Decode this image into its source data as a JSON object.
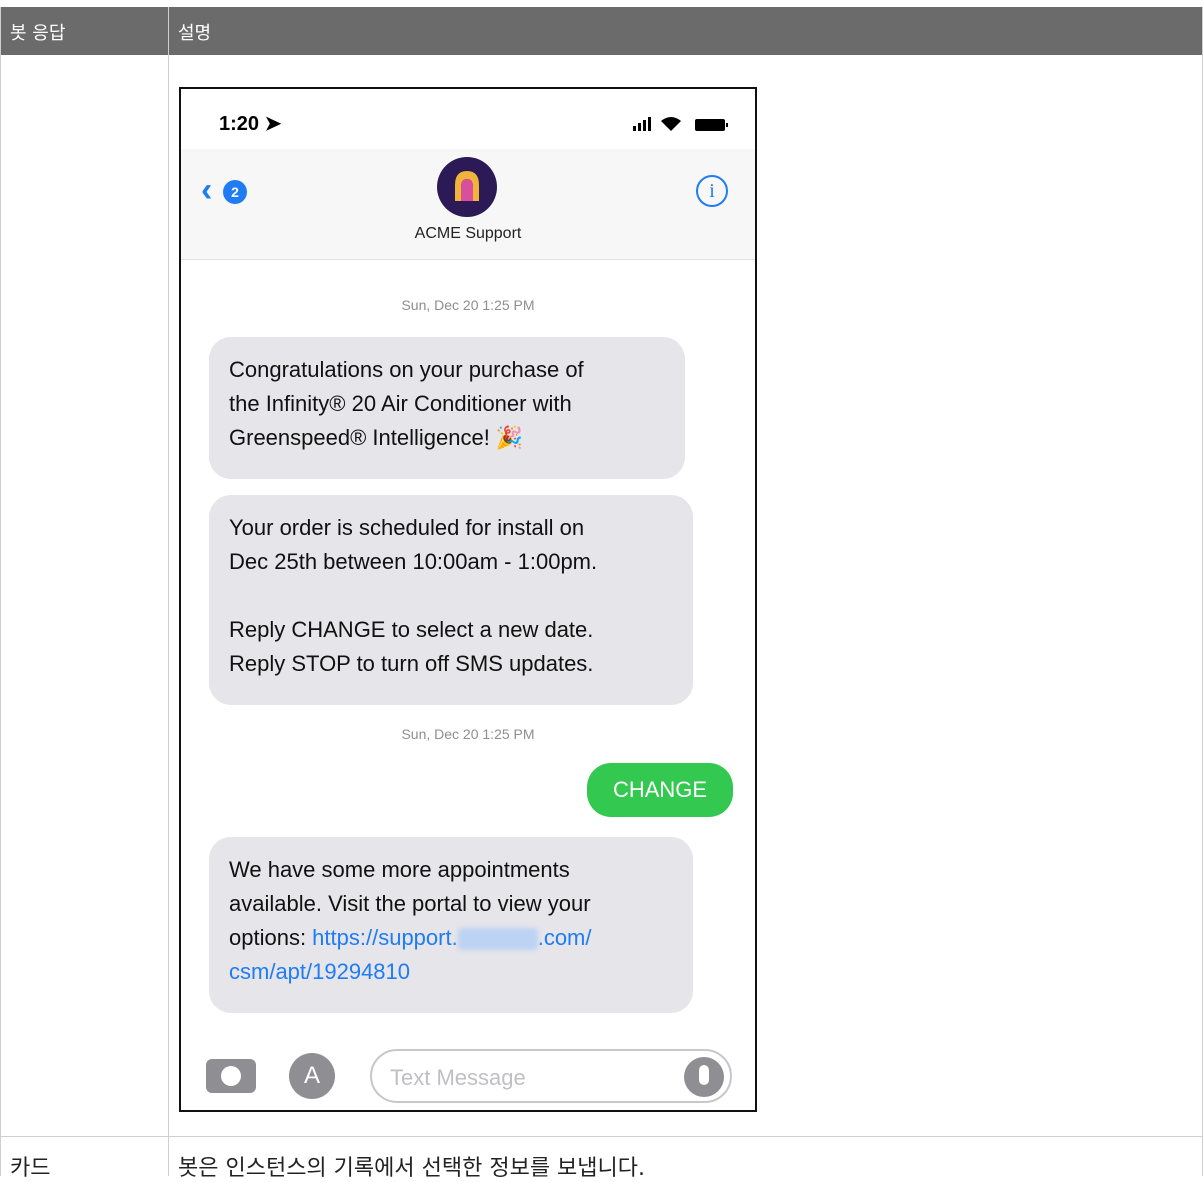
{
  "table": {
    "header_col1": "봇 응답",
    "header_col2": "설명",
    "row2_col1": "카드",
    "row2_col2": "봇은 인스턴스의 기록에서 선택한 정보를 보냅니다."
  },
  "phone": {
    "status_time": "1:20",
    "back_badge": "2",
    "contact_name": "ACME Support",
    "timestamp1": "Sun, Dec 20 1:25 PM",
    "msg1": "Congratulations on your purchase of\nthe Infinity® 20 Air Conditioner with\nGreenspeed® Intelligence! 🎉",
    "msg2": "Your order is scheduled for install on\nDec 25th between 10:00am - 1:00pm.\n\nReply CHANGE to select a new date.\nReply STOP to turn off SMS updates.",
    "timestamp2": "Sun, Dec 20 1:25 PM",
    "sent_msg": "CHANGE",
    "msg3_text": "We have some more appointments\navailable. Visit the portal to view your\noptions: ",
    "msg3_link_start": "https://support.",
    "msg3_link_end": ".com/\ncsm/apt/19294810",
    "input_placeholder": "Text Message",
    "colors": {
      "accent": "#1f7cf3",
      "sent_bubble": "#33c84f",
      "recv_bubble": "#e5e5ea",
      "header_bg": "#6b6b6b"
    }
  }
}
